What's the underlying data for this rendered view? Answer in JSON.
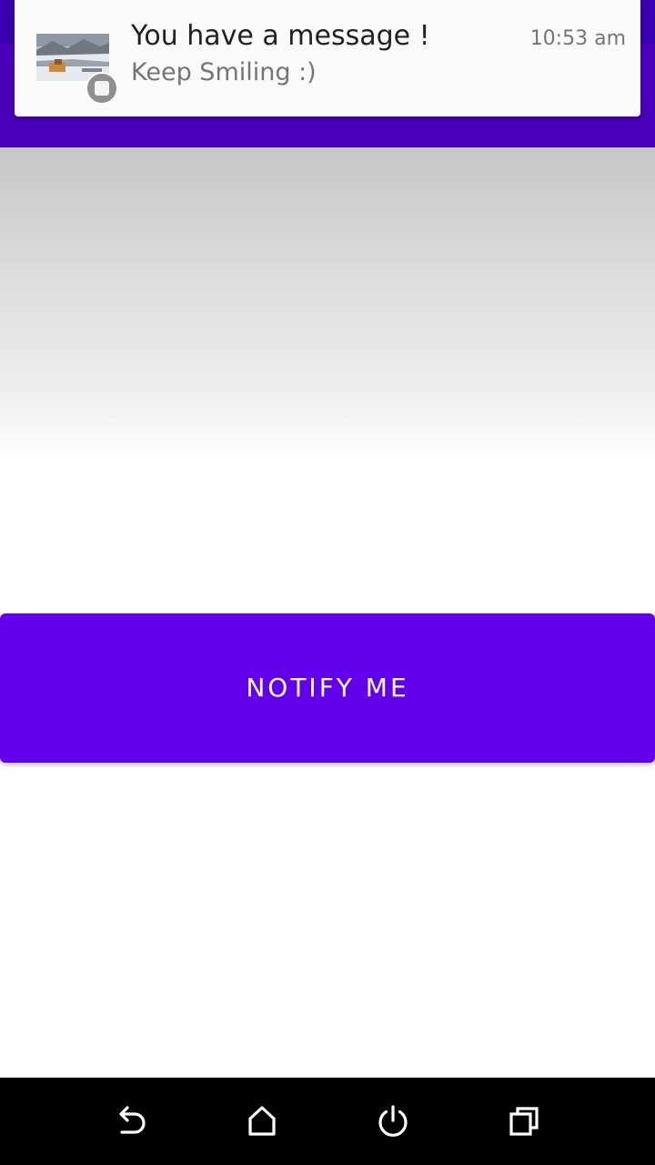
{
  "theme": {
    "status_bar_color": "#3a00b0",
    "app_bar_color": "#4a00b8",
    "accent_color": "#6200ee",
    "nav_bar_color": "#000000"
  },
  "notification": {
    "title": "You have a message !",
    "text": "Keep Smiling :)",
    "time": "10:53 am",
    "thumbnail_icon": "landscape-thumbnail",
    "badge_icon": "app-small-icon"
  },
  "main": {
    "notify_button_label": "NOTIFY ME"
  },
  "navigation": {
    "buttons": [
      {
        "name": "back",
        "icon": "back-icon"
      },
      {
        "name": "home",
        "icon": "home-icon"
      },
      {
        "name": "power",
        "icon": "power-icon"
      },
      {
        "name": "recents",
        "icon": "recents-icon"
      }
    ]
  }
}
